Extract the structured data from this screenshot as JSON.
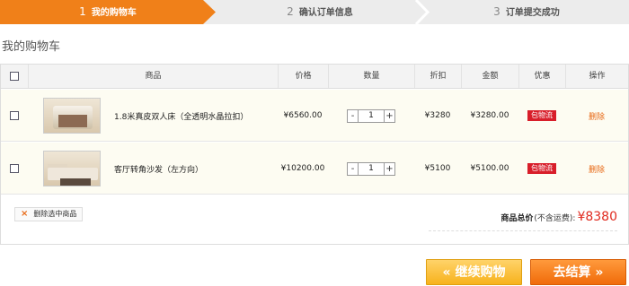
{
  "steps": [
    {
      "num": "1",
      "label": "我的购物车"
    },
    {
      "num": "2",
      "label": "确认订单信息"
    },
    {
      "num": "3",
      "label": "订单提交成功"
    }
  ],
  "page_title": "我的购物车",
  "table": {
    "headers": {
      "product": "商品",
      "price": "价格",
      "quantity": "数量",
      "discount": "折扣",
      "amount": "金额",
      "promo": "优惠",
      "action": "操作"
    },
    "rows": [
      {
        "name": "1.8米真皮双人床（全透明水晶拉扣）",
        "price": "¥6560.00",
        "qty_minus": "-",
        "quantity": "1",
        "qty_plus": "+",
        "discount": "¥3280",
        "amount": "¥3280.00",
        "promo": "包物流",
        "action": "删除",
        "thumb_icon": "bed-photo"
      },
      {
        "name": "客厅转角沙发（左方向）",
        "price": "¥10200.00",
        "qty_minus": "-",
        "quantity": "1",
        "qty_plus": "+",
        "discount": "¥5100",
        "amount": "¥5100.00",
        "promo": "包物流",
        "action": "删除",
        "thumb_icon": "sofa-photo"
      }
    ]
  },
  "footer": {
    "delete_selected_icon": "×",
    "delete_selected": "删除选中商品",
    "total_label": "商品总价",
    "total_note": "(不含运费):",
    "total_value": "¥8380"
  },
  "buttons": {
    "continue": "« 继续购物",
    "checkout": "去结算 »"
  },
  "colors": {
    "accent": "#f08019",
    "price_red": "#e02a1f",
    "badge_red": "#d81e2a",
    "link_orange": "#e86a17"
  }
}
